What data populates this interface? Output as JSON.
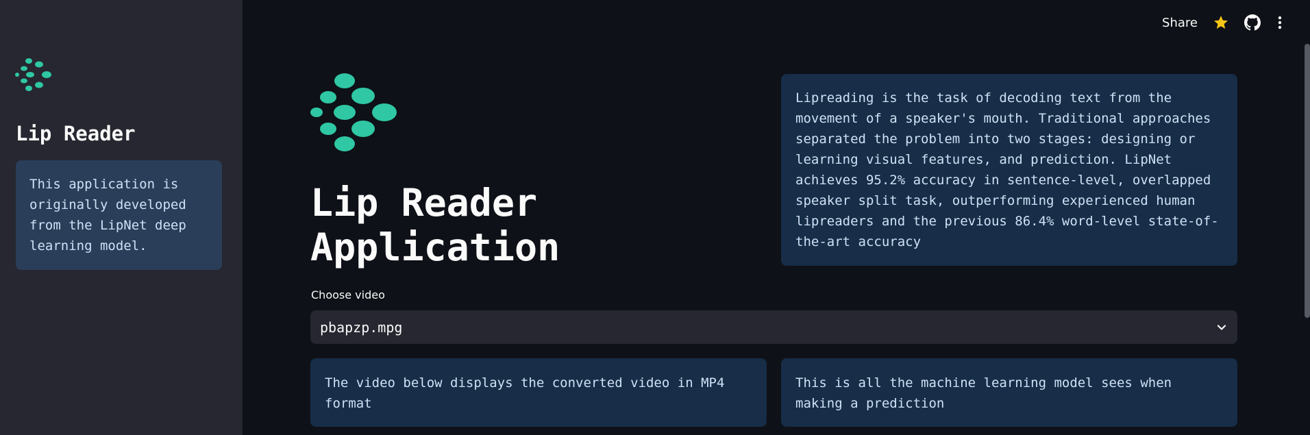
{
  "sidebar": {
    "title": "Lip Reader",
    "info": "This application is originally developed from the LipNet deep learning model."
  },
  "topbar": {
    "share_label": "Share",
    "icons": [
      "star-icon",
      "github-icon",
      "kebab-menu-icon"
    ]
  },
  "main": {
    "heading": "Lip Reader Application",
    "about": "Lipreading is the task of decoding text from the movement of a speaker's mouth. Traditional approaches separated the problem into two stages: designing or learning visual features, and prediction. LipNet achieves 95.2% accuracy in sentence-level, overlapped speaker split task, outperforming experienced human lipreaders and the previous 86.4% word-level state-of-the-art accuracy",
    "choose_label": "Choose video",
    "selected_video": "pbapzp.mpg",
    "note_left": "The video below displays the converted video in MP4 format",
    "note_right": "This is all the machine learning model sees when making a prediction"
  },
  "colors": {
    "accent": "#2fc7a4",
    "star": "#f5c518",
    "info_bg": "#172d48"
  }
}
